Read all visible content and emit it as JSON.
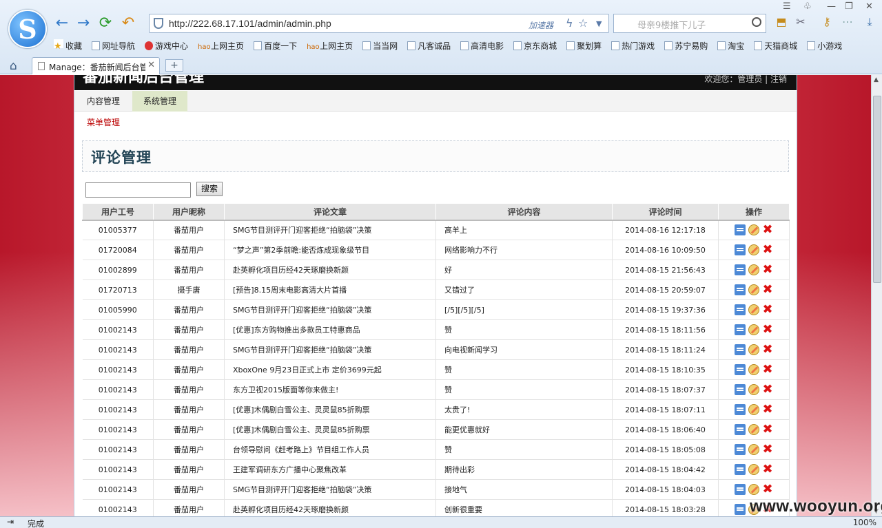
{
  "browser": {
    "url": "http://222.68.17.101/admin/admin.php",
    "accelerator": "加速器",
    "search_placeholder": "母亲9楼推下儿子",
    "tab_title": "Manage：番茄新闻后台管",
    "status": "完成",
    "zoom": "100%",
    "bookmarks": [
      "收藏",
      "网址导航",
      "游戏中心",
      "上网主页",
      "百度一下",
      "上网主页",
      "当当网",
      "凡客诚品",
      "高清电影",
      "京东商城",
      "聚划算",
      "热门游戏",
      "苏宁易购",
      "淘宝",
      "天猫商城",
      "小游戏"
    ]
  },
  "site": {
    "title": "番茄新闻后台管理",
    "welcome": "欢迎您：管理员 | 注销"
  },
  "menu": {
    "content": "内容管理",
    "system": "系统管理",
    "sub": "菜单管理"
  },
  "page": {
    "title": "评论管理",
    "search_button": "搜索",
    "search_value": ""
  },
  "table": {
    "headers": [
      "用户工号",
      "用户昵称",
      "评论文章",
      "评论内容",
      "评论时间",
      "操作"
    ],
    "rows": [
      [
        "01005377",
        "番茄用户",
        "SMG节目测评开门迎客拒绝“拍脑袋”决策",
        "高羊上",
        "2014-08-16 12:17:18"
      ],
      [
        "01720084",
        "番茄用户",
        "“梦之声”第2季前瞻:能否炼成现象级节目",
        "网络影响力不行",
        "2014-08-16 10:09:50"
      ],
      [
        "01002899",
        "番茄用户",
        "赴英孵化项目历经42天琢磨换新颜",
        "好",
        "2014-08-15 21:56:43"
      ],
      [
        "01720713",
        "摄手唐",
        "[预告]8.15周末电影高清大片首播",
        "又错过了",
        "2014-08-15 20:59:07"
      ],
      [
        "01005990",
        "番茄用户",
        "SMG节目测评开门迎客拒绝“拍脑袋”决策",
        "[/5][/5][/5]",
        "2014-08-15 19:37:36"
      ],
      [
        "01002143",
        "番茄用户",
        "[优惠]东方购物推出多款员工特惠商品",
        "赞",
        "2014-08-15 18:11:56"
      ],
      [
        "01002143",
        "番茄用户",
        "SMG节目测评开门迎客拒绝“拍脑袋”决策",
        "向电视新闻学习",
        "2014-08-15 18:11:24"
      ],
      [
        "01002143",
        "番茄用户",
        "XboxOne 9月23日正式上市 定价3699元起",
        "赞",
        "2014-08-15 18:10:35"
      ],
      [
        "01002143",
        "番茄用户",
        "东方卫视2015版面等你来做主!",
        "赞",
        "2014-08-15 18:07:37"
      ],
      [
        "01002143",
        "番茄用户",
        "[优惠]木偶剧白雪公主、灵灵鼠85折购票",
        "太贵了!",
        "2014-08-15 18:07:11"
      ],
      [
        "01002143",
        "番茄用户",
        "[优惠]木偶剧白雪公主、灵灵鼠85折购票",
        "能更优惠就好",
        "2014-08-15 18:06:40"
      ],
      [
        "01002143",
        "番茄用户",
        "台领导慰问《赶考路上》节目组工作人员",
        "赞",
        "2014-08-15 18:05:08"
      ],
      [
        "01002143",
        "番茄用户",
        "王建军调研东方广播中心聚焦改革",
        "期待出彩",
        "2014-08-15 18:04:42"
      ],
      [
        "01002143",
        "番茄用户",
        "SMG节目测评开门迎客拒绝“拍脑袋”决策",
        "接地气",
        "2014-08-15 18:04:03"
      ],
      [
        "01002143",
        "番茄用户",
        "赴英孵化项目历经42天琢磨换新颜",
        "创新很重要",
        "2014-08-15 18:03:28"
      ]
    ]
  },
  "watermark": "www.wooyun.org"
}
